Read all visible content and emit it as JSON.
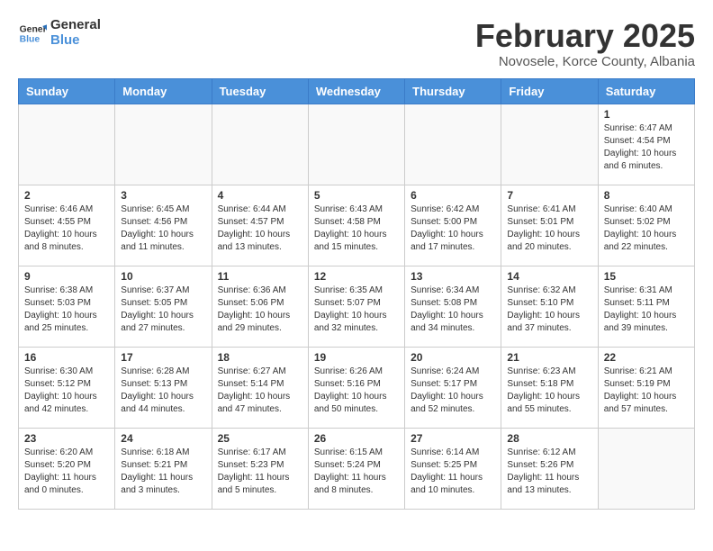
{
  "header": {
    "logo_general": "General",
    "logo_blue": "Blue",
    "title": "February 2025",
    "subtitle": "Novosele, Korce County, Albania"
  },
  "days_of_week": [
    "Sunday",
    "Monday",
    "Tuesday",
    "Wednesday",
    "Thursday",
    "Friday",
    "Saturday"
  ],
  "weeks": [
    [
      {
        "day": "",
        "info": ""
      },
      {
        "day": "",
        "info": ""
      },
      {
        "day": "",
        "info": ""
      },
      {
        "day": "",
        "info": ""
      },
      {
        "day": "",
        "info": ""
      },
      {
        "day": "",
        "info": ""
      },
      {
        "day": "1",
        "info": "Sunrise: 6:47 AM\nSunset: 4:54 PM\nDaylight: 10 hours and 6 minutes."
      }
    ],
    [
      {
        "day": "2",
        "info": "Sunrise: 6:46 AM\nSunset: 4:55 PM\nDaylight: 10 hours and 8 minutes."
      },
      {
        "day": "3",
        "info": "Sunrise: 6:45 AM\nSunset: 4:56 PM\nDaylight: 10 hours and 11 minutes."
      },
      {
        "day": "4",
        "info": "Sunrise: 6:44 AM\nSunset: 4:57 PM\nDaylight: 10 hours and 13 minutes."
      },
      {
        "day": "5",
        "info": "Sunrise: 6:43 AM\nSunset: 4:58 PM\nDaylight: 10 hours and 15 minutes."
      },
      {
        "day": "6",
        "info": "Sunrise: 6:42 AM\nSunset: 5:00 PM\nDaylight: 10 hours and 17 minutes."
      },
      {
        "day": "7",
        "info": "Sunrise: 6:41 AM\nSunset: 5:01 PM\nDaylight: 10 hours and 20 minutes."
      },
      {
        "day": "8",
        "info": "Sunrise: 6:40 AM\nSunset: 5:02 PM\nDaylight: 10 hours and 22 minutes."
      }
    ],
    [
      {
        "day": "9",
        "info": "Sunrise: 6:38 AM\nSunset: 5:03 PM\nDaylight: 10 hours and 25 minutes."
      },
      {
        "day": "10",
        "info": "Sunrise: 6:37 AM\nSunset: 5:05 PM\nDaylight: 10 hours and 27 minutes."
      },
      {
        "day": "11",
        "info": "Sunrise: 6:36 AM\nSunset: 5:06 PM\nDaylight: 10 hours and 29 minutes."
      },
      {
        "day": "12",
        "info": "Sunrise: 6:35 AM\nSunset: 5:07 PM\nDaylight: 10 hours and 32 minutes."
      },
      {
        "day": "13",
        "info": "Sunrise: 6:34 AM\nSunset: 5:08 PM\nDaylight: 10 hours and 34 minutes."
      },
      {
        "day": "14",
        "info": "Sunrise: 6:32 AM\nSunset: 5:10 PM\nDaylight: 10 hours and 37 minutes."
      },
      {
        "day": "15",
        "info": "Sunrise: 6:31 AM\nSunset: 5:11 PM\nDaylight: 10 hours and 39 minutes."
      }
    ],
    [
      {
        "day": "16",
        "info": "Sunrise: 6:30 AM\nSunset: 5:12 PM\nDaylight: 10 hours and 42 minutes."
      },
      {
        "day": "17",
        "info": "Sunrise: 6:28 AM\nSunset: 5:13 PM\nDaylight: 10 hours and 44 minutes."
      },
      {
        "day": "18",
        "info": "Sunrise: 6:27 AM\nSunset: 5:14 PM\nDaylight: 10 hours and 47 minutes."
      },
      {
        "day": "19",
        "info": "Sunrise: 6:26 AM\nSunset: 5:16 PM\nDaylight: 10 hours and 50 minutes."
      },
      {
        "day": "20",
        "info": "Sunrise: 6:24 AM\nSunset: 5:17 PM\nDaylight: 10 hours and 52 minutes."
      },
      {
        "day": "21",
        "info": "Sunrise: 6:23 AM\nSunset: 5:18 PM\nDaylight: 10 hours and 55 minutes."
      },
      {
        "day": "22",
        "info": "Sunrise: 6:21 AM\nSunset: 5:19 PM\nDaylight: 10 hours and 57 minutes."
      }
    ],
    [
      {
        "day": "23",
        "info": "Sunrise: 6:20 AM\nSunset: 5:20 PM\nDaylight: 11 hours and 0 minutes."
      },
      {
        "day": "24",
        "info": "Sunrise: 6:18 AM\nSunset: 5:21 PM\nDaylight: 11 hours and 3 minutes."
      },
      {
        "day": "25",
        "info": "Sunrise: 6:17 AM\nSunset: 5:23 PM\nDaylight: 11 hours and 5 minutes."
      },
      {
        "day": "26",
        "info": "Sunrise: 6:15 AM\nSunset: 5:24 PM\nDaylight: 11 hours and 8 minutes."
      },
      {
        "day": "27",
        "info": "Sunrise: 6:14 AM\nSunset: 5:25 PM\nDaylight: 11 hours and 10 minutes."
      },
      {
        "day": "28",
        "info": "Sunrise: 6:12 AM\nSunset: 5:26 PM\nDaylight: 11 hours and 13 minutes."
      },
      {
        "day": "",
        "info": ""
      }
    ]
  ]
}
